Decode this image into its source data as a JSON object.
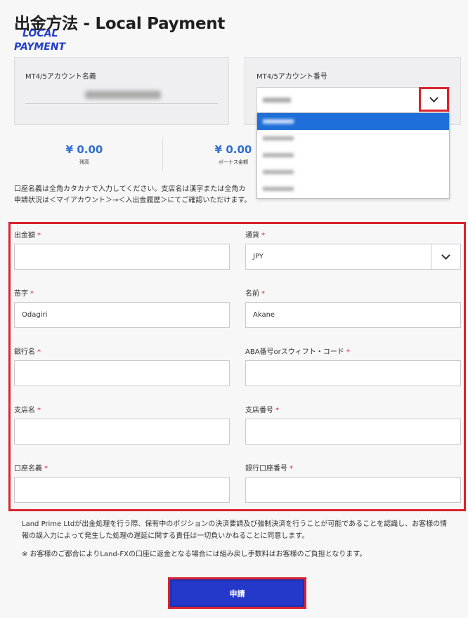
{
  "header": {
    "title": "出金方法 - Local Payment",
    "logo_line1": "LOCAL",
    "logo_line2": "PAYMENT"
  },
  "account": {
    "name_label": "MT4/5アカウント名義",
    "number_label": "MT4/5アカウント番号",
    "dropdown_items": 5,
    "dropdown_selected_index": 0
  },
  "balances": {
    "balance_amount": "¥ 0.00",
    "balance_label": "残高",
    "bonus_amount": "¥ 0.00",
    "bonus_label": "ボーナス金額"
  },
  "notice": {
    "line1": "口座名義は全角カタカナで入力してください。支店名は漢字または全角カ",
    "line2": "申請状況は＜マイアカウント＞→＜入出金履歴＞にてご確認いただけます。"
  },
  "form": {
    "required_mark": "*",
    "amount": {
      "label": "出金額",
      "value": ""
    },
    "currency": {
      "label": "通貨",
      "value": "JPY"
    },
    "last_name": {
      "label": "苗字",
      "value": "Odagiri"
    },
    "first_name": {
      "label": "名前",
      "value": "Akane"
    },
    "bank_name": {
      "label": "銀行名",
      "value": ""
    },
    "aba_swift": {
      "label": "ABA番号orスウィフト・コード",
      "value": ""
    },
    "branch_name": {
      "label": "支店名",
      "value": ""
    },
    "branch_number": {
      "label": "支店番号",
      "value": ""
    },
    "account_holder": {
      "label": "口座名義",
      "value": ""
    },
    "account_number": {
      "label": "銀行口座番号",
      "value": ""
    }
  },
  "disclaimer": "Land Prime Ltdが出金処理を行う際、保有中のポジションの決済要請及び強制決済を行うことが可能であることを認識し、お客様の情報の誤入力によって発生した処理の遅延に関する責任は一切負いかねることに同意します。",
  "note": "※ お客様のご都合によりLand-FXの口座に返金となる場合には組み戻し手数料はお客様のご負担となります。",
  "submit_label": "申請",
  "colors": {
    "accent_blue": "#2438c9",
    "highlight_red": "#d9232d",
    "selected_blue": "#1e6fd9",
    "amount_blue": "#2f6fd3"
  }
}
